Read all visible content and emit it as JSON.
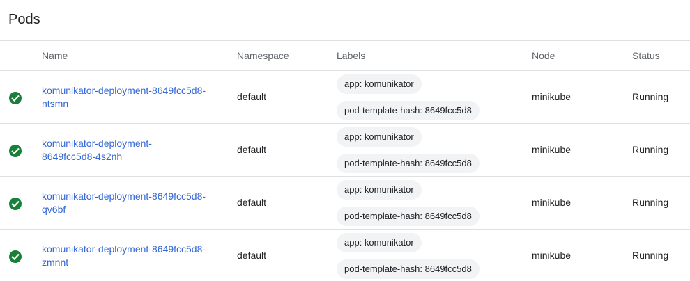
{
  "title": "Pods",
  "columns": {
    "name": "Name",
    "namespace": "Namespace",
    "labels": "Labels",
    "node": "Node",
    "status": "Status"
  },
  "colors": {
    "status_ok": "#188038",
    "link": "#3367d6",
    "chip_bg": "#f1f3f4"
  },
  "rows": [
    {
      "status_icon": "check-circle-icon",
      "name_line1": "komunikator-deployment-8649fcc5d8-",
      "name_line2": "ntsmn",
      "namespace": "default",
      "labels": [
        "app: komunikator",
        "pod-template-hash: 8649fcc5d8"
      ],
      "node": "minikube",
      "status": "Running"
    },
    {
      "status_icon": "check-circle-icon",
      "name_line1": "komunikator-deployment-",
      "name_line2": "8649fcc5d8-4s2nh",
      "namespace": "default",
      "labels": [
        "app: komunikator",
        "pod-template-hash: 8649fcc5d8"
      ],
      "node": "minikube",
      "status": "Running"
    },
    {
      "status_icon": "check-circle-icon",
      "name_line1": "komunikator-deployment-8649fcc5d8-",
      "name_line2": "qv6bf",
      "namespace": "default",
      "labels": [
        "app: komunikator",
        "pod-template-hash: 8649fcc5d8"
      ],
      "node": "minikube",
      "status": "Running"
    },
    {
      "status_icon": "check-circle-icon",
      "name_line1": "komunikator-deployment-8649fcc5d8-",
      "name_line2": "zmnnt",
      "namespace": "default",
      "labels": [
        "app: komunikator",
        "pod-template-hash: 8649fcc5d8"
      ],
      "node": "minikube",
      "status": "Running"
    }
  ]
}
